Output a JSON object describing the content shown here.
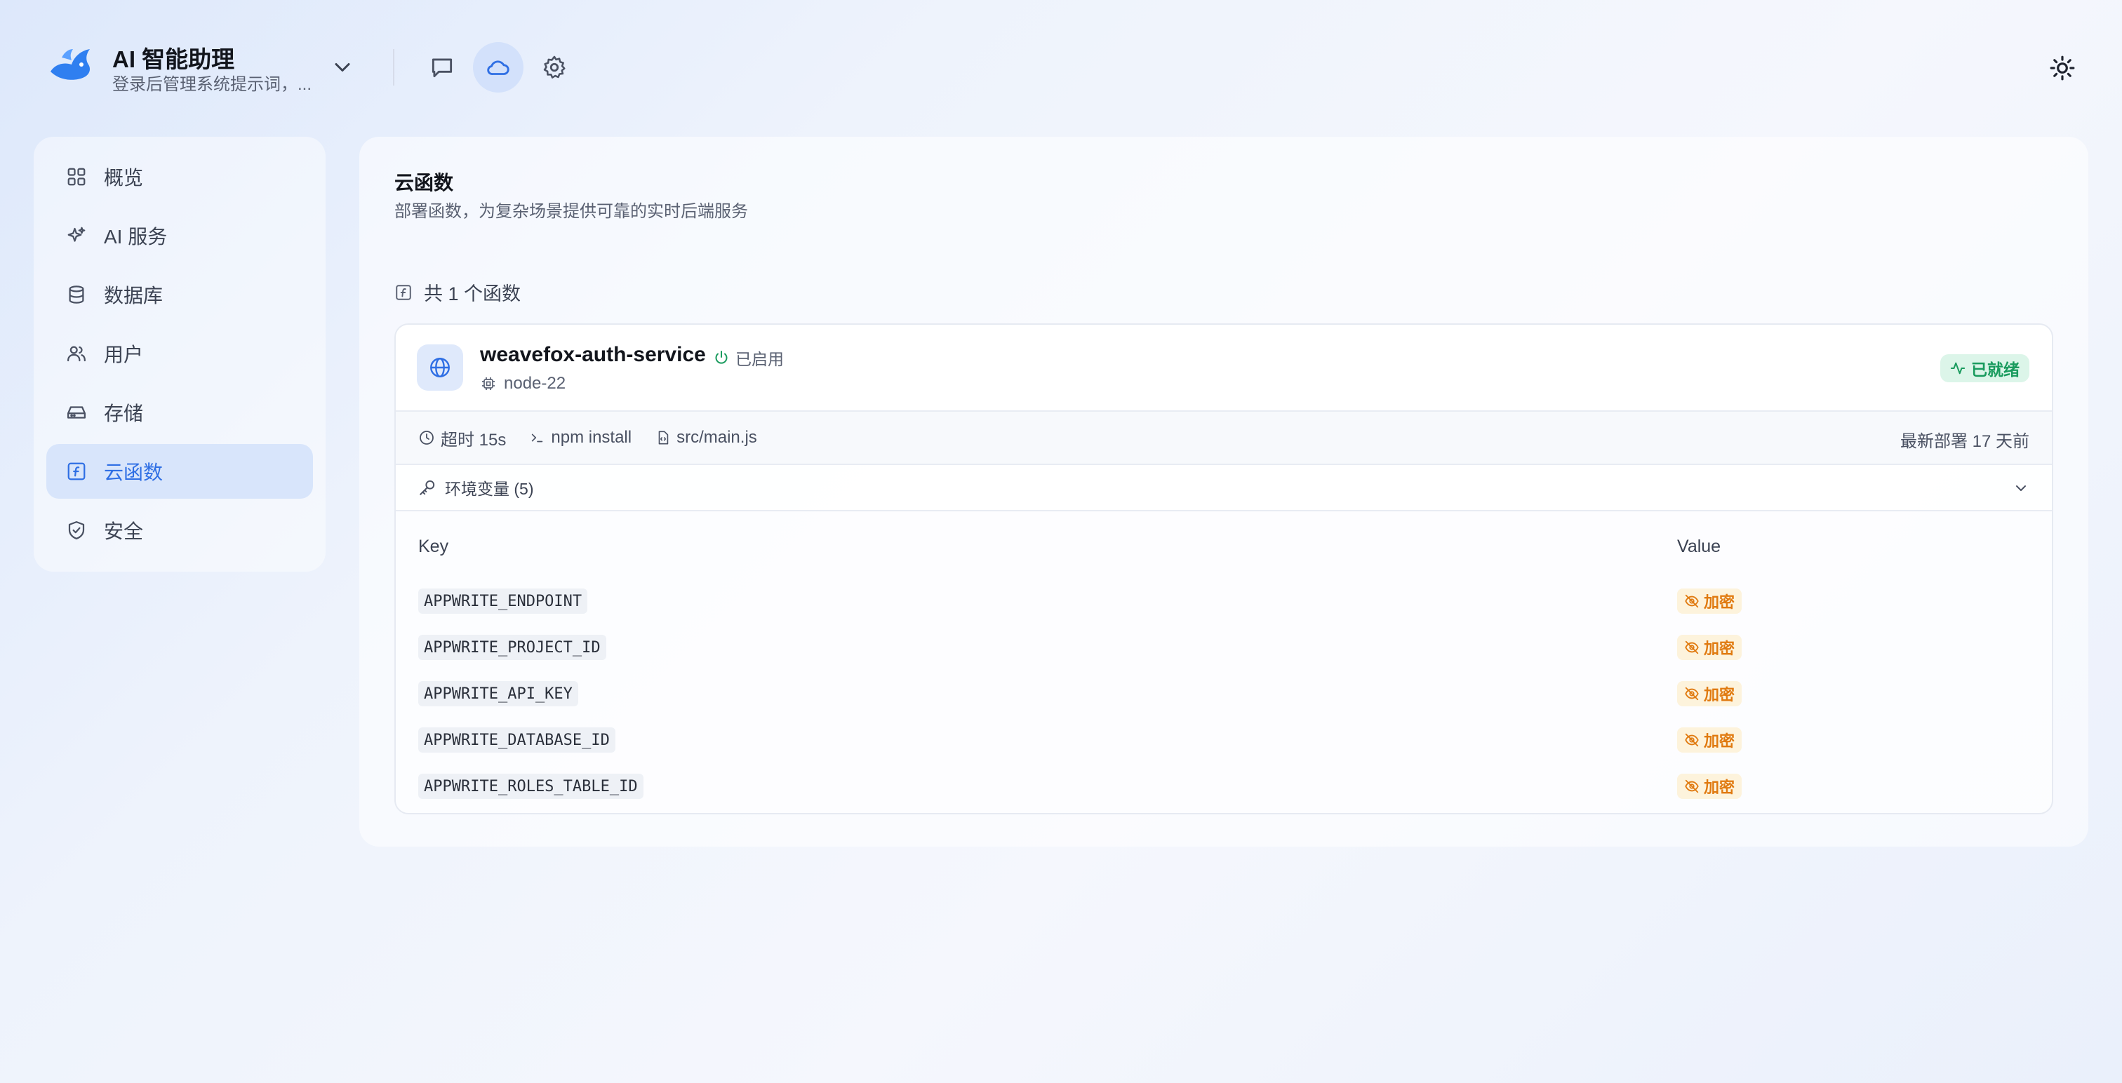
{
  "header": {
    "app_title": "AI 智能助理",
    "app_subtitle": "登录后管理系统提示词，...",
    "buttons": [
      {
        "icon": "chat-icon",
        "active": false
      },
      {
        "icon": "cloud-icon",
        "active": true
      },
      {
        "icon": "gear-icon",
        "active": false
      }
    ],
    "theme_icon": "sun-icon"
  },
  "sidebar": {
    "items": [
      {
        "label": "概览",
        "icon": "grid-icon",
        "active": false
      },
      {
        "label": "AI 服务",
        "icon": "sparkles-icon",
        "active": false
      },
      {
        "label": "数据库",
        "icon": "database-icon",
        "active": false
      },
      {
        "label": "用户",
        "icon": "users-icon",
        "active": false
      },
      {
        "label": "存储",
        "icon": "hard-drive-icon",
        "active": false
      },
      {
        "label": "云函数",
        "icon": "function-icon",
        "active": true
      },
      {
        "label": "安全",
        "icon": "shield-icon",
        "active": false
      }
    ]
  },
  "main": {
    "title": "云函数",
    "description": "部署函数，为复杂场景提供可靠的实时后端服务",
    "count_label": "共 1 个函数",
    "function": {
      "name": "weavefox-auth-service",
      "enabled_label": "已启用",
      "runtime": "node-22",
      "status": "已就绪",
      "timeout": "超时 15s",
      "build_command": "npm install",
      "entrypoint": "src/main.js",
      "last_deploy": "最新部署 17 天前",
      "env_label": "环境变量 (5)",
      "table": {
        "key_header": "Key",
        "value_header": "Value",
        "rows": [
          {
            "key": "APPWRITE_ENDPOINT",
            "value": "加密"
          },
          {
            "key": "APPWRITE_PROJECT_ID",
            "value": "加密"
          },
          {
            "key": "APPWRITE_API_KEY",
            "value": "加密"
          },
          {
            "key": "APPWRITE_DATABASE_ID",
            "value": "加密"
          },
          {
            "key": "APPWRITE_ROLES_TABLE_ID",
            "value": "加密"
          }
        ]
      }
    }
  },
  "colors": {
    "accent": "#2f6fe4",
    "success": "#1a9b5e",
    "warning": "#e07a10"
  }
}
